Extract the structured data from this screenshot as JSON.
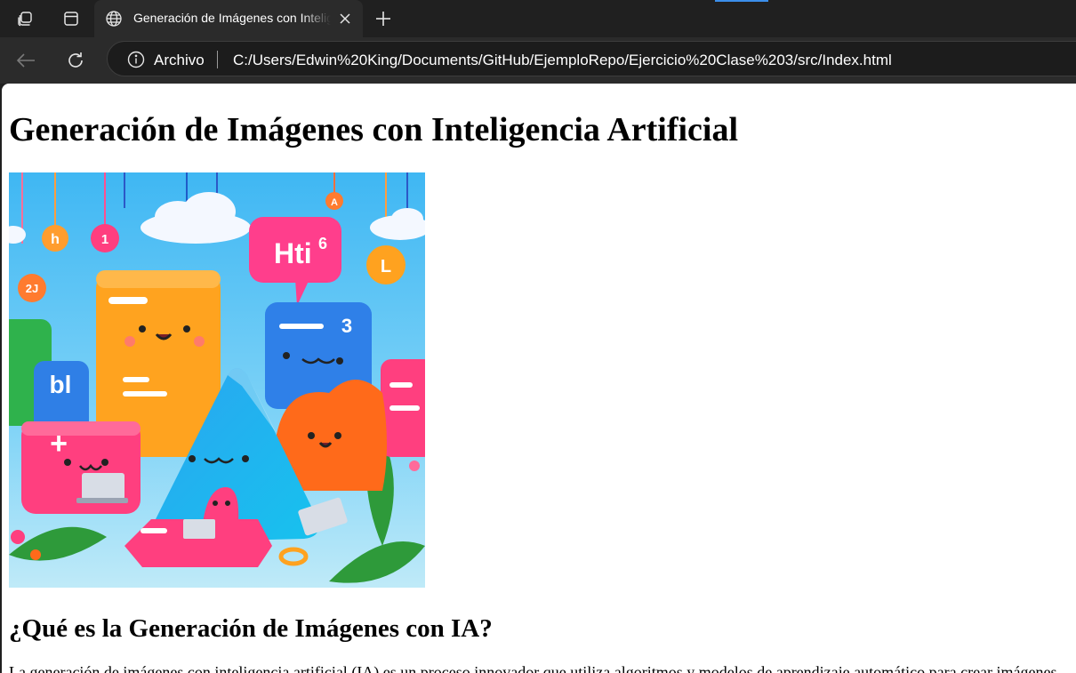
{
  "tabbar": {
    "tab_title": "Generación de Imágenes con Inteligencia Artificial",
    "icons": [
      "workspaces-icon",
      "tab-actions-icon",
      "globe-icon",
      "close-icon",
      "plus-icon"
    ]
  },
  "toolbar": {
    "site_label": "Archivo",
    "url": "C:/Users/Edwin%20King/Documents/GitHub/EjemploRepo/Ejercicio%20Clase%203/src/Index.html",
    "icons": [
      "back-arrow-icon",
      "refresh-icon",
      "info-icon"
    ]
  },
  "page": {
    "heading": "Generación de Imágenes con Inteligencia Artificial",
    "subheading": "¿Qué es la Generación de Imágenes con IA?",
    "paragraph": "La generación de imágenes con inteligencia artificial (IA) es un proceso innovador que utiliza algoritmos y modelos de aprendizaje automático para crear imágenes",
    "hero_image": {
      "description": "colorful cartoon illustration of smiling letter shapes, laptops, speech bubble and hanging ornaments",
      "speech_bubble_text": "Hti",
      "ornament_letters": [
        "h",
        "1",
        "6",
        "2J",
        "A",
        "L",
        "bl",
        "3",
        "+"
      ]
    }
  },
  "colors": {
    "chrome_dark": "#202020",
    "chrome_toolbar": "#2b2b2b",
    "page_bg": "#ffffff",
    "accent": "#3b8eea"
  }
}
